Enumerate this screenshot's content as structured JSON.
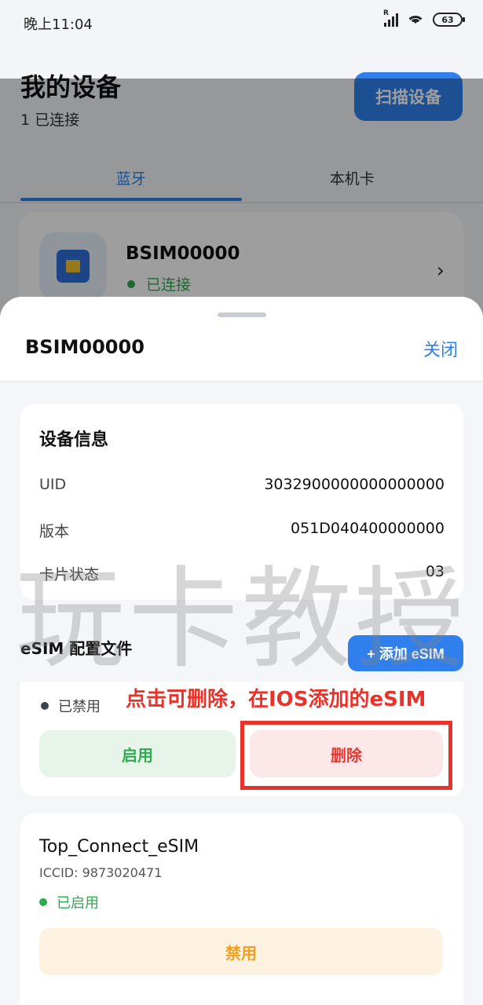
{
  "status_bar": {
    "time": "晚上11:04",
    "battery": "63"
  },
  "page": {
    "title": "我的设备",
    "subtitle": "1 已连接",
    "scan_button": "扫描设备",
    "tabs": [
      {
        "label": "蓝牙",
        "active": true
      },
      {
        "label": "本机卡",
        "active": false
      }
    ]
  },
  "device": {
    "name": "BSIM00000",
    "status": "已连接"
  },
  "sheet": {
    "title": "BSIM00000",
    "close_label": "关闭",
    "info": {
      "heading": "设备信息",
      "rows": [
        {
          "label": "UID",
          "value": "3032900000000000000"
        },
        {
          "label": "版本",
          "value": "051D040400000000"
        },
        {
          "label": "卡片状态",
          "value": "03"
        }
      ]
    },
    "esim": {
      "heading": "eSIM 配置文件",
      "add_button": "+ 添加 eSIM",
      "profiles": [
        {
          "status": "已禁用",
          "enable_button": "启用",
          "delete_button": "删除"
        },
        {
          "name": "Top_Connect_eSIM",
          "iccid": "ICCID: 9873020471",
          "status": "已启用",
          "disable_button": "禁用"
        }
      ]
    }
  },
  "annotation": {
    "text": "点击可删除，在IOS添加的eSIM",
    "color": "#e8322a"
  },
  "watermark": "玩卡教授",
  "colors": {
    "accent": "#2f80ed",
    "success": "#2eab4f",
    "danger": "#e53935",
    "warning": "#f0a020"
  }
}
